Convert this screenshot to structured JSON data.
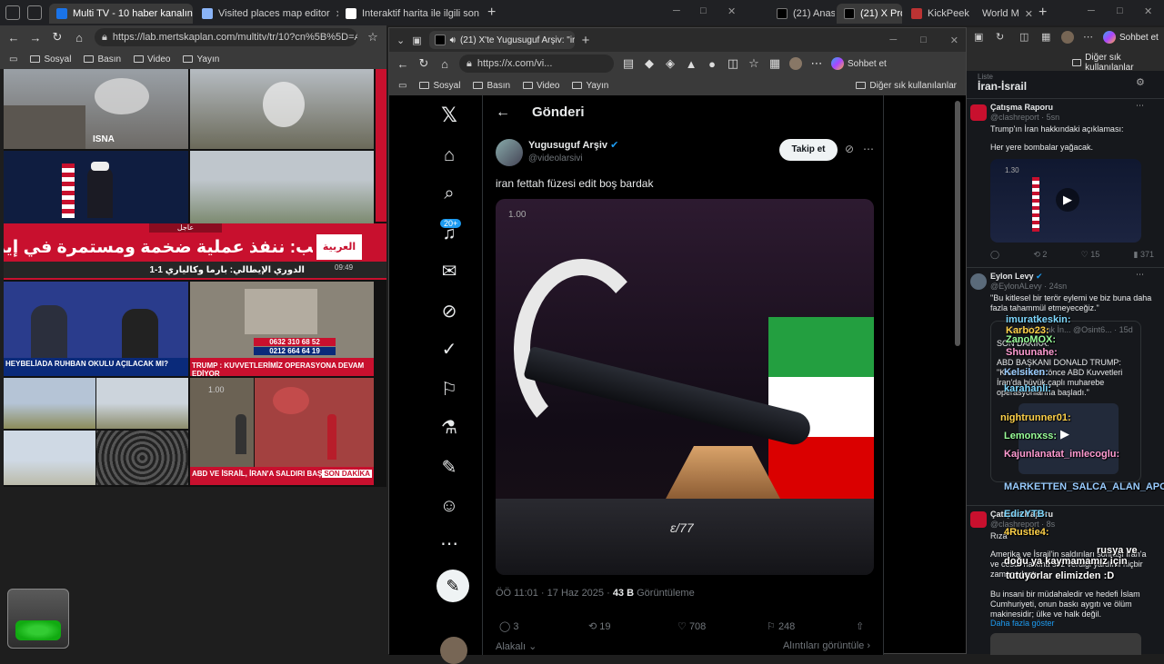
{
  "browser": {
    "tabs": [
      {
        "label": "Multi TV - 10 haber kanalını aynı a",
        "active": true
      },
      {
        "label": "Visited places map editor",
        "active": false
      },
      {
        "label": "Interaktif harita ile ilgili son İran ha",
        "active": false
      },
      {
        "label": "(21) Anası",
        "active": false
      },
      {
        "label": "(21) X Pro",
        "active": false
      },
      {
        "label": "KickPeek",
        "active": false
      },
      {
        "label": "World M",
        "active": false
      }
    ],
    "url": "https://lab.mertskaplan.com/multitv/tr/10?cn%5B%5D=Al...",
    "bookmarks": [
      "Sosyal",
      "Basın",
      "Video",
      "Yayın"
    ],
    "right_bookmarks": "Diğer sık kullanılanlar",
    "sohbet": "Sohbet et"
  },
  "news": {
    "isna": "ISNA",
    "arabic_headline": "ترمب: ننفذ عملية ضخمة ومستمرة في إيران",
    "arabic_sub": "الدوري الإيطالي: بارما وكالياري 1-1",
    "urgent": "عاجل",
    "alarabiya": "العربية",
    "time1": "09:49",
    "phone1": "0632 310 68 52",
    "phone2": "0212 664 64 19",
    "heybeliada": "HEYBELİADA RUHBAN OKULU AÇILACAK MI?",
    "trump_ticker": "TRUMP : KUVVETLERİMİZ OPERASYONA DEVAM EDİYOR",
    "abd_ticker": "ABD VE İSRAİL, İRAN'A SALDIRI BAŞLATTI",
    "son_dakika": "SON DAKİKA",
    "small_label": "1.00"
  },
  "xwindow": {
    "tab_title": "(21) X'te Yugusuguf Arşiv: \"ira",
    "url": "https://x.com/vi...",
    "bookmarks": [
      "Sosyal",
      "Basın",
      "Video",
      "Yayın"
    ],
    "right_bookmarks": "Diğer sık kullanılanlar",
    "sohbet": "Sohbet et",
    "notif_badge": "20+",
    "header": "Gönderi",
    "author_name": "Yugusuguf Arşiv",
    "author_handle": "@videolarsivi",
    "follow": "Takip et",
    "post_text": "iran fettah füzesi edit boş bardak",
    "video_rate": "1.00",
    "video_watermark": "ɛ/77",
    "timestamp": "ÖÖ 11:01 · 17 Haz 2025 · ",
    "views_count": "43 B",
    "views_label": "Görüntüleme",
    "replies": "3",
    "reposts": "19",
    "likes": "708",
    "bookmarks_count": "248",
    "alakali": "Alakalı",
    "alintilar": "Alıntıları görüntüle"
  },
  "feed": {
    "list_label": "Liste",
    "list_title": "İran-İsrail",
    "post1": {
      "name": "Çatışma Raporu",
      "handle": "@clashreport · 5sn",
      "line1": "Trump'ın İran hakkındaki açıklaması:",
      "line2": "Her yere bombalar yağacak.",
      "video_rate": "1.30",
      "replies": "",
      "reposts": "2",
      "likes": "15",
      "views": "371"
    },
    "post2": {
      "name": "Eylon Levy",
      "handle": "@EylonALevy · 24sn",
      "text": "\"Bu kitlesel bir terör eylemi ve biz buna daha fazla tahammül etmeyeceğiz.\"",
      "quote_handle": "Açık Kaynak İn... @Osint6... · 15d",
      "quote_text1": "SON DAKİKA:",
      "quote_text2": "ABD BAŞKANI DONALD TRUMP: \"Kısa bir süre önce ABD Kuvvetleri İran'da büyük çaplı muharebe operasyonlarına başladı.\""
    },
    "post3": {
      "name": "Çatışma Raporu",
      "handle": "@clashreport · 8s",
      "l1": "Rıza",
      "l2": "Amerika ve İsrail'in saldırıları sonrası İran'a ve cesur halkına söz verdiği yardımı hiçbir zaman ulaştı.",
      "l3": "Bu insani bir müdahaledir ve hedefi İslam Cumhuriyeti, onun baskı aygıtı ve ölüm makinesidir; ülke ve halk değil.",
      "more": "Daha fazla göster"
    }
  },
  "chat": [
    {
      "user": "imuratkeskin:",
      "msg": ""
    },
    {
      "user": "Karbo23:",
      "msg": ""
    },
    {
      "user": "ZanoMOX:",
      "msg": ""
    },
    {
      "user": "Shuunahe:",
      "msg": ""
    },
    {
      "user": "Kelsiken:",
      "msg": ""
    },
    {
      "user": "karahanli:",
      "msg": ""
    },
    {
      "user": "nightrunner01:",
      "msg": ""
    },
    {
      "user": "Lemonxss:",
      "msg": ""
    },
    {
      "user": "Kajunlanatat_imlecoglu:",
      "msg": ""
    },
    {
      "user": "MARKETTEN_SALCA_ALAN_APO:",
      "msg": ""
    },
    {
      "user": "EdizYTB:",
      "msg": ""
    },
    {
      "user": "4Rustie4:",
      "msg": ""
    },
    {
      "user": "",
      "msg": "rusya ve"
    },
    {
      "user": "",
      "msg": "doğu ya kaymamamız için"
    },
    {
      "user": "",
      "msg": "tutuyorlar elimizden :D"
    }
  ],
  "colors": {
    "accent": "#1d9bf0",
    "red": "#c8102e",
    "badge": "#1d9bf0"
  }
}
